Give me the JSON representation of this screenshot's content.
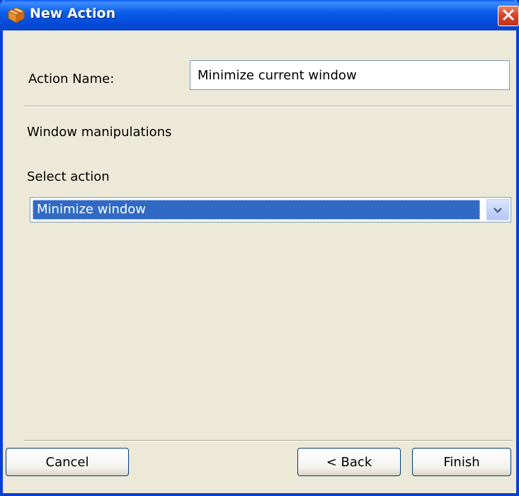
{
  "window": {
    "title": "New Action",
    "title_icon": "package-box-icon",
    "close_icon": "close-x-icon"
  },
  "form": {
    "action_name_label": "Action Name:",
    "action_name_value": "Minimize current window",
    "section_heading": "Window manipulations",
    "select_label": "Select action",
    "select_value": "Minimize window",
    "select_arrow_icon": "chevron-down-icon"
  },
  "buttons": {
    "cancel": "Cancel",
    "back": "< Back",
    "finish": "Finish"
  },
  "colors": {
    "titlebar": "#0a5fe8",
    "selection": "#316ac5",
    "dialog_bg": "#ece9d8",
    "close_button": "#d9452b"
  }
}
